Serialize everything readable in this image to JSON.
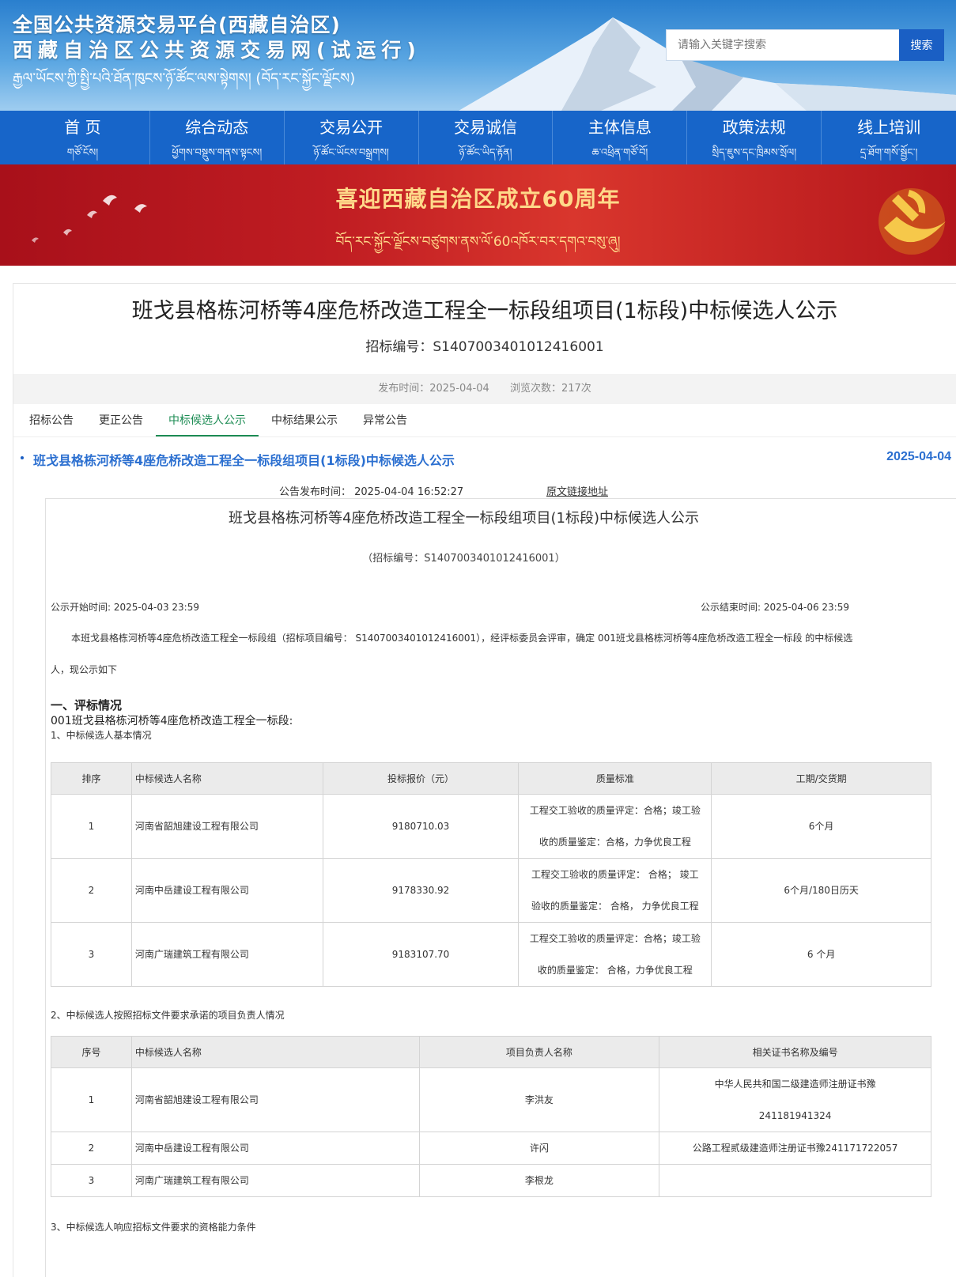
{
  "header": {
    "title_cn": "全国公共资源交易平台(西藏自治区)",
    "title_cn2": "西藏自治区公共资源交易网(试运行)",
    "title_bo": "རྒྱལ་ཡོངས་ཀྱི་སྤྱི་པའི་ཐོན་ཁུངས་ཉོ་ཚོང་ལས་སྟེགས། (བོད་རང་སྐྱོང་ལྗོངས)",
    "search_placeholder": "请输入关键字搜索",
    "search_button": "搜索"
  },
  "nav": [
    {
      "zh": "首 页",
      "bo": "གཙོ་ངོས།"
    },
    {
      "zh": "综合动态",
      "bo": "ཕྱོགས་བསྡུས་གནས་སྟངས།"
    },
    {
      "zh": "交易公开",
      "bo": "ཉོ་ཚོང་ཡོངས་བསྒྲགས།"
    },
    {
      "zh": "交易诚信",
      "bo": "ཉོ་ཚོང་ཡིད་རྟོན།"
    },
    {
      "zh": "主体信息",
      "bo": "ཆ་འཕྲིན་གཙོ་བོ།"
    },
    {
      "zh": "政策法规",
      "bo": "སྲིད་ཇུས་དང་ཁྲིམས་སྲོལ།"
    },
    {
      "zh": "线上培训",
      "bo": "དྲ་ཐོག་གསོ་སྦྱོང་།"
    }
  ],
  "banner": {
    "main": "喜迎西藏自治区成立60周年",
    "sub": "བོད་རང་སྐྱོང་ལྗོངས་བཙུགས་ནས་ལོ་60འཁོར་བར་དགའ་བསུ་ཞུ།"
  },
  "page": {
    "title": "班戈县格栋河桥等4座危桥改造工程全一标段组项目(1标段)中标候选人公示",
    "code": "招标编号：S1407003401012416001",
    "publish_time": "发布时间：2025-04-04",
    "views": "浏览次数：217次"
  },
  "tabs": [
    "招标公告",
    "更正公告",
    "中标候选人公示",
    "中标结果公示",
    "异常公告"
  ],
  "announcement": {
    "title": "班戈县格栋河桥等4座危桥改造工程全一标段组项目(1标段)中标候选人公示",
    "date": "2025-04-04",
    "publish_time": "公告发布时间：  2025-04-04 16:52:27",
    "source_link": "原文链接地址"
  },
  "doc": {
    "title": "班戈县格栋河桥等4座危桥改造工程全一标段组项目(1标段)中标候选人公示",
    "code": "（招标编号：S1407003401012416001）",
    "start": "公示开始时间: 2025-04-03 23:59",
    "end": "公示结束时间: 2025-04-06 23:59",
    "para_line1": "本班戈县格栋河桥等4座危桥改造工程全一标段组（招标项目编号： S1407003401012416001），经评标委员会评审，确定 001班戈县格栋河桥等4座危桥改造工程全一标段 的中标候选",
    "para_line2": "人，现公示如下",
    "section1": "一、评标情况",
    "section1_sub": "001班戈县格栋河桥等4座危桥改造工程全一标段:",
    "section1_item1": "1、中标候选人基本情况",
    "section1_item2": "2、中标候选人按照招标文件要求承诺的项目负责人情况",
    "section1_item3": "3、中标候选人响应招标文件要求的资格能力条件"
  },
  "table1": {
    "headers": [
      "排序",
      "中标候选人名称",
      "投标报价（元）",
      "质量标准",
      "工期/交货期"
    ],
    "rows": [
      {
        "rank": "1",
        "name": "河南省韶旭建设工程有限公司",
        "price": "9180710.03",
        "q1": "工程交工验收的质量评定：合格；竣工验",
        "q2": "收的质量鉴定：合格，力争优良工程",
        "period": "6个月"
      },
      {
        "rank": "2",
        "name": "河南中岳建设工程有限公司",
        "price": "9178330.92",
        "q1": "工程交工验收的质量评定： 合格； 竣工",
        "q2": "验收的质量鉴定： 合格， 力争优良工程",
        "period": "6个月/180日历天"
      },
      {
        "rank": "3",
        "name": "河南广瑞建筑工程有限公司",
        "price": "9183107.70",
        "q1": "工程交工验收的质量评定：合格；竣工验",
        "q2": "收的质量鉴定： 合格，力争优良工程",
        "period": "6 个月"
      }
    ]
  },
  "table2": {
    "headers": [
      "序号",
      "中标候选人名称",
      "项目负责人名称",
      "相关证书名称及编号"
    ],
    "rows": [
      {
        "no": "1",
        "name": "河南省韶旭建设工程有限公司",
        "manager": "李洪友",
        "cert1": "中华人民共和国二级建造师注册证书豫",
        "cert2": "241181941324"
      },
      {
        "no": "2",
        "name": "河南中岳建设工程有限公司",
        "manager": "许闪",
        "cert1": "公路工程贰级建造师注册证书豫241171722057",
        "cert2": ""
      },
      {
        "no": "3",
        "name": "河南广瑞建筑工程有限公司",
        "manager": "李根龙",
        "cert1": "",
        "cert2": ""
      }
    ]
  }
}
